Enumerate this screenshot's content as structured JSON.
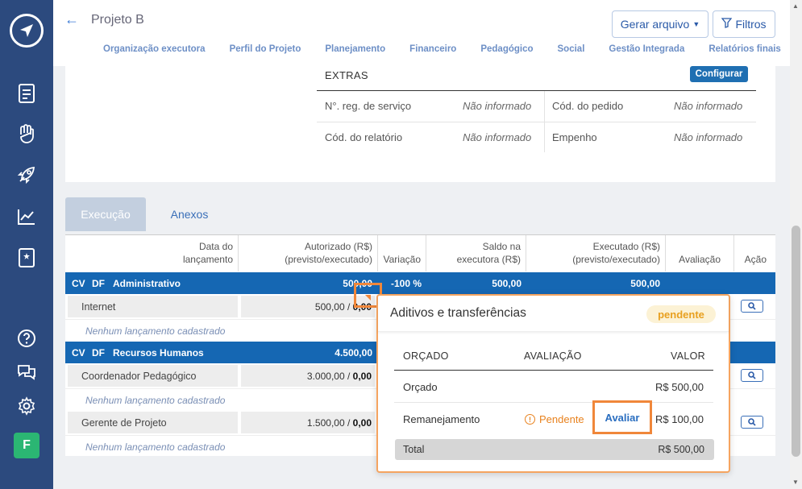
{
  "sidebar": {
    "avatar": "F",
    "icons": [
      "send-icon",
      "document-icon",
      "hand-heart-icon",
      "rocket-icon",
      "chart-icon",
      "book-icon",
      "help-icon",
      "chat-icon",
      "gear-icon"
    ]
  },
  "header": {
    "title": "Projeto B",
    "gerar_label": "Gerar arquivo",
    "filtros_label": "Filtros",
    "tabs": [
      "Organização executora",
      "Perfil do Projeto",
      "Planejamento",
      "Financeiro",
      "Pedagógico",
      "Social",
      "Gestão Integrada",
      "Relatórios finais"
    ]
  },
  "extras": {
    "title": "EXTRAS",
    "config_label": "Configurar",
    "fields": [
      {
        "label": "N°. reg. de serviço",
        "value": "Não informado"
      },
      {
        "label": "Cód. do pedido",
        "value": "Não informado"
      },
      {
        "label": "Cód. do relatório",
        "value": "Não informado"
      },
      {
        "label": "Empenho",
        "value": "Não informado"
      }
    ]
  },
  "tabs": {
    "exec": "Execução",
    "anexos": "Anexos"
  },
  "table": {
    "headers": {
      "data": [
        "Data do",
        "lançamento"
      ],
      "autorizado": [
        "Autorizado (R$)",
        "(previsto/executado)"
      ],
      "variacao": "Variação",
      "saldo": [
        "Saldo na",
        "executora (R$)"
      ],
      "executado": [
        "Executado (R$)",
        "(previsto/executado)"
      ],
      "avaliacao": "Avaliação",
      "acao": "Ação"
    },
    "categories": [
      {
        "cv": "CV",
        "df": "DF",
        "name": "Administrativo",
        "autorizado": "500,00",
        "variacao": "-100 %",
        "saldo": "500,00",
        "executado": "500,00"
      },
      {
        "cv": "CV",
        "df": "DF",
        "name": "Recursos Humanos",
        "autorizado": "4.500,00"
      }
    ],
    "items": [
      {
        "name": "Internet",
        "prev": "500,00 / ",
        "exec": "0,00"
      },
      {
        "name": "Coordenador Pedagógico",
        "prev": "3.000,00 / ",
        "exec": "0,00"
      },
      {
        "name": "Gerente de Projeto",
        "prev": "1.500,00 / ",
        "exec": "0,00"
      }
    ],
    "empty": "Nenhum lançamento cadastrado"
  },
  "popup": {
    "title": "Aditivos e transferências",
    "badge": "pendente",
    "col_orcado": "ORÇADO",
    "col_avaliacao": "AVALIAÇÃO",
    "col_valor": "VALOR",
    "row1_label": "Orçado",
    "row1_value": "R$ 500,00",
    "row2_label": "Remanejamento",
    "row2_status": "Pendente",
    "row2_action": "Avaliar",
    "row2_value": "R$ 100,00",
    "total_label": "Total",
    "total_value": "R$ 500,00"
  }
}
